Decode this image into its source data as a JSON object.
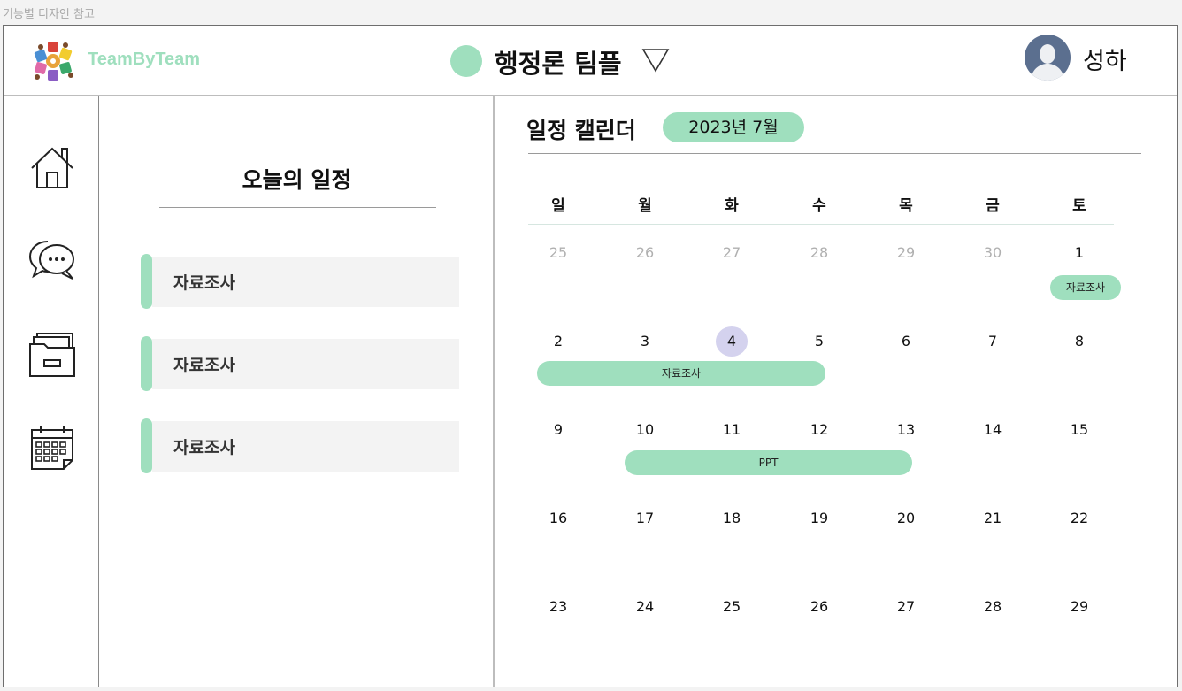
{
  "frame_label": "기능별 디자인 참고",
  "header": {
    "brand": "TeamByTeam",
    "team_name": "행정론 팀플",
    "user_name": "성하",
    "colors": {
      "accent": "#9fdfbe"
    }
  },
  "sidebar": {
    "icons": [
      "home-icon",
      "chat-icon",
      "folder-icon",
      "calendar-icon"
    ]
  },
  "today": {
    "title": "오늘의 일정",
    "tasks": [
      "자료조사",
      "자료조사",
      "자료조사"
    ]
  },
  "calendar": {
    "title": "일정 캘린더",
    "month": "2023년 7월",
    "weekdays": [
      "일",
      "월",
      "화",
      "수",
      "목",
      "금",
      "토"
    ],
    "weeks": [
      [
        "25",
        "26",
        "27",
        "28",
        "29",
        "30",
        "1"
      ],
      [
        "2",
        "3",
        "4",
        "5",
        "6",
        "7",
        "8"
      ],
      [
        "9",
        "10",
        "11",
        "12",
        "13",
        "14",
        "15"
      ],
      [
        "16",
        "17",
        "18",
        "19",
        "20",
        "21",
        "22"
      ],
      [
        "23",
        "24",
        "25",
        "26",
        "27",
        "28",
        "29"
      ]
    ],
    "selected_day": "4",
    "events": [
      {
        "label": "자료조사",
        "start": "7/1",
        "end": "7/1"
      },
      {
        "label": "자료조사",
        "start": "7/2",
        "end": "7/5"
      },
      {
        "label": "PPT",
        "start": "7/10",
        "end": "7/13"
      }
    ]
  }
}
